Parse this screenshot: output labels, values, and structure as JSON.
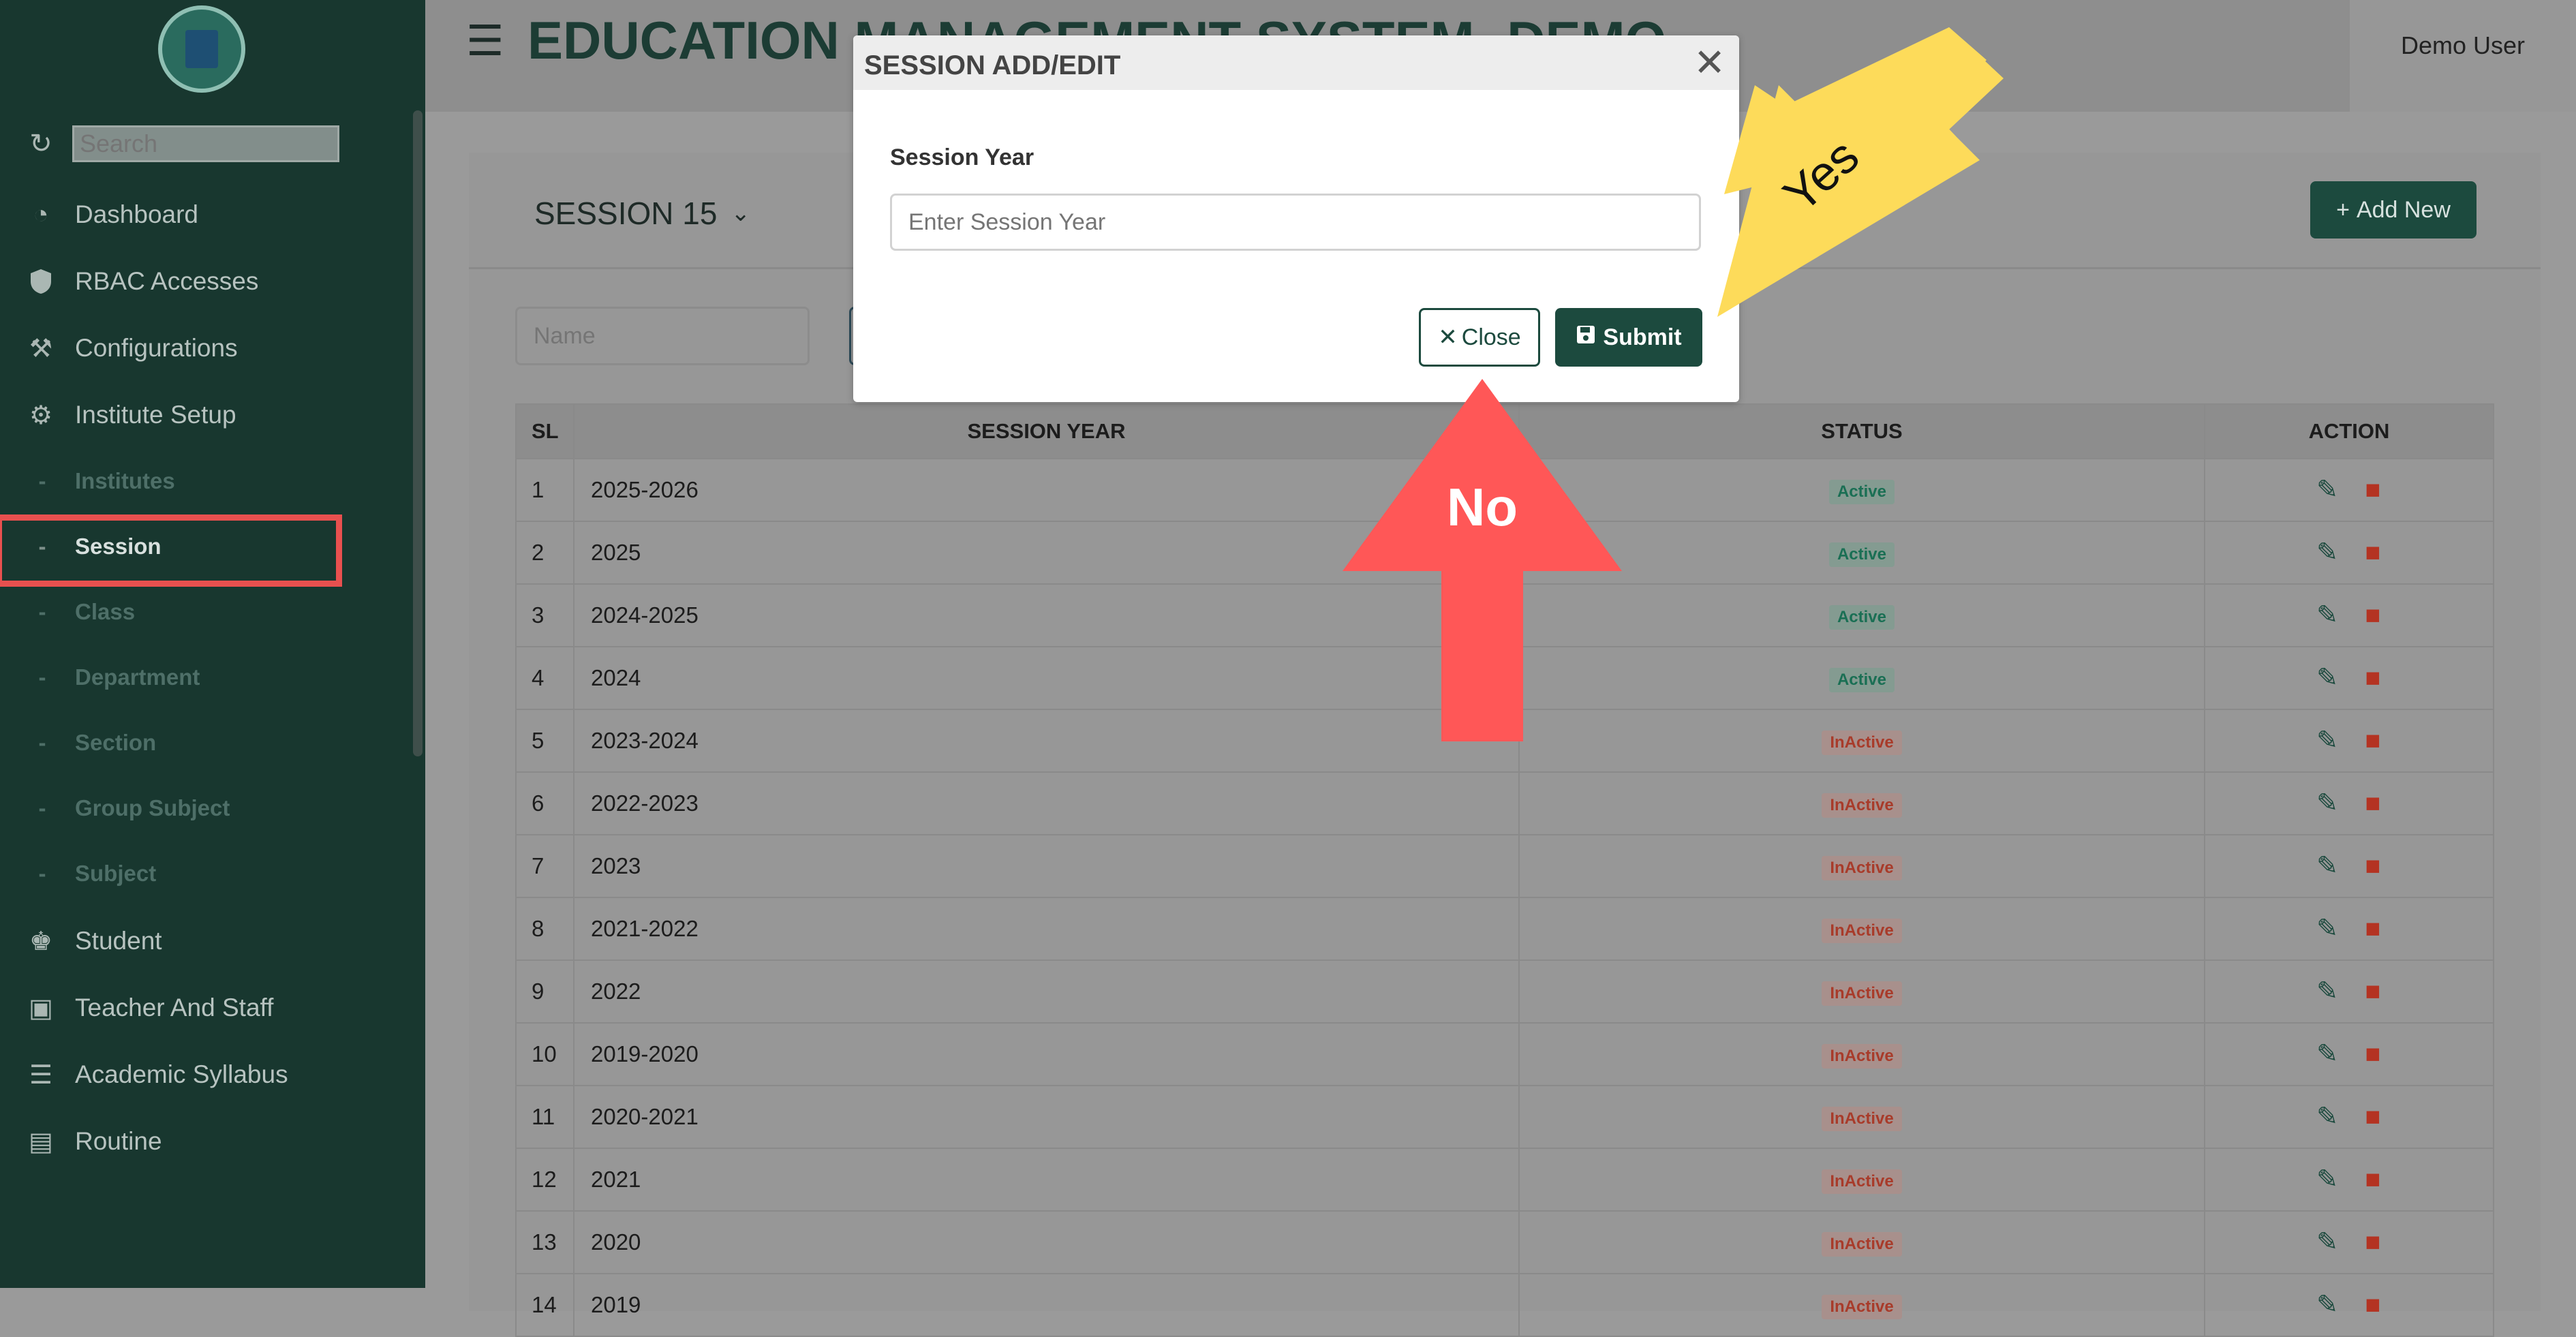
{
  "sidebar": {
    "search_placeholder": "Search",
    "items": [
      {
        "label": "Dashboard",
        "icon": "gauge-icon"
      },
      {
        "label": "RBAC Accesses",
        "icon": "shield-icon"
      },
      {
        "label": "Configurations",
        "icon": "tools-icon"
      },
      {
        "label": "Institute Setup",
        "icon": "gear-icon"
      }
    ],
    "sub_items": [
      "Institutes",
      "Session",
      "Class",
      "Department",
      "Section",
      "Group Subject",
      "Subject"
    ],
    "active_sub_item": "Session",
    "lower_items": [
      {
        "label": "Student",
        "icon": "graduate-icon"
      },
      {
        "label": "Teacher And Staff",
        "icon": "teacher-board-icon"
      },
      {
        "label": "Academic Syllabus",
        "icon": "document-icon"
      },
      {
        "label": "Routine",
        "icon": "clipboard-icon"
      }
    ]
  },
  "header": {
    "title": "EDUCATION MANAGEMENT SYSTEM- DEMO",
    "user": "Demo User"
  },
  "card": {
    "session_selector": "SESSION 15",
    "add_button": "Add New",
    "name_placeholder": "Name"
  },
  "table": {
    "columns": [
      "SL",
      "SESSION YEAR",
      "STATUS",
      "ACTION"
    ],
    "rows": [
      {
        "sl": "1",
        "year": "2025-2026",
        "status": "Active"
      },
      {
        "sl": "2",
        "year": "2025",
        "status": "Active"
      },
      {
        "sl": "3",
        "year": "2024-2025",
        "status": "Active"
      },
      {
        "sl": "4",
        "year": "2024",
        "status": "Active"
      },
      {
        "sl": "5",
        "year": "2023-2024",
        "status": "InActive"
      },
      {
        "sl": "6",
        "year": "2022-2023",
        "status": "InActive"
      },
      {
        "sl": "7",
        "year": "2023",
        "status": "InActive"
      },
      {
        "sl": "8",
        "year": "2021-2022",
        "status": "InActive"
      },
      {
        "sl": "9",
        "year": "2022",
        "status": "InActive"
      },
      {
        "sl": "10",
        "year": "2019-2020",
        "status": "InActive"
      },
      {
        "sl": "11",
        "year": "2020-2021",
        "status": "InActive"
      },
      {
        "sl": "12",
        "year": "2021",
        "status": "InActive"
      },
      {
        "sl": "13",
        "year": "2020",
        "status": "InActive"
      },
      {
        "sl": "14",
        "year": "2019",
        "status": "InActive"
      }
    ]
  },
  "modal": {
    "title": "SESSION ADD/EDIT",
    "field_label": "Session Year",
    "field_placeholder": "Enter Session Year",
    "close_label": "Close",
    "submit_label": "Submit"
  },
  "annotations": {
    "yes_label": "Yes",
    "no_label": "No",
    "yes_color": "#fddb5a",
    "no_color": "#ff5757",
    "highlight_color": "#e8504f"
  }
}
